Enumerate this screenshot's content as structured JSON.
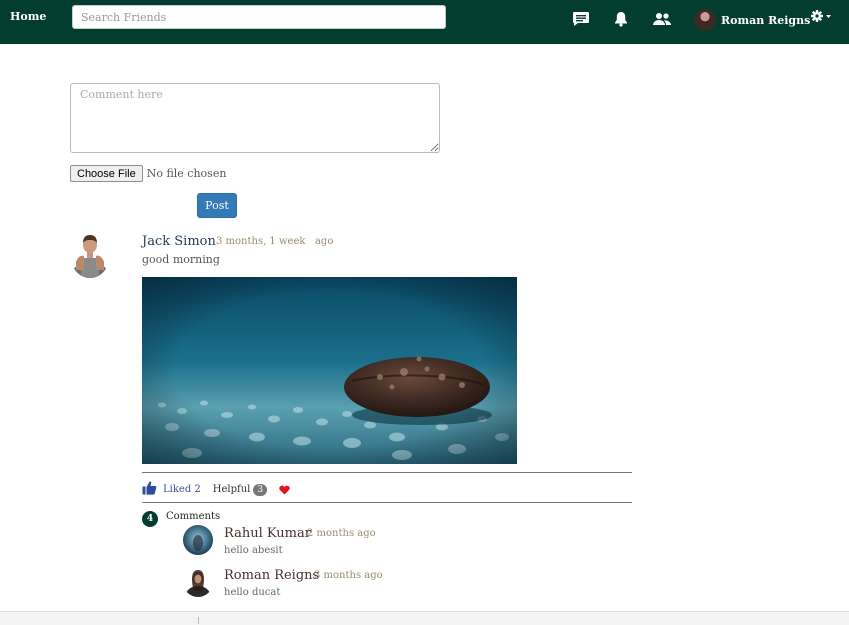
{
  "navbar": {
    "home_label": "Home",
    "search_placeholder": "Search Friends",
    "user_name": "Roman Reigns",
    "brand_color": "#033d2f",
    "icons": [
      "chat-icon",
      "bell-icon",
      "friends-icon",
      "gear-icon"
    ]
  },
  "post_form": {
    "comment_placeholder": "Comment here",
    "choose_file_label": "Choose File",
    "no_file_text": "No file chosen",
    "post_button_label": "Post"
  },
  "post": {
    "author": "Jack Simon",
    "time": "3 months, 1 week   ago",
    "text": "good morning",
    "liked_label": "Liked 2",
    "helpful_label": "Helpful",
    "helpful_count": "3",
    "comments_count": "4",
    "comments_label": "Comments",
    "comments": [
      {
        "author": "Rahul Kumar",
        "time": "2 months ago",
        "text": "hello abesit"
      },
      {
        "author": "Roman Reigns",
        "time": "3 months ago",
        "text": "hello ducat"
      }
    ]
  }
}
